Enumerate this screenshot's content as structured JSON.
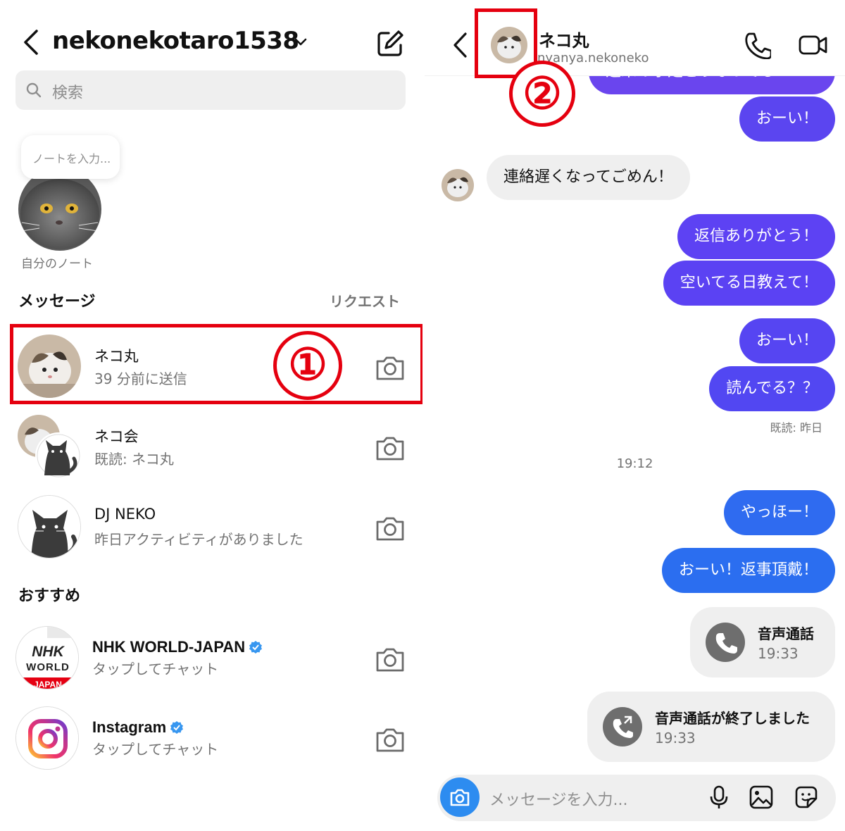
{
  "left": {
    "username": "nekonekotaro1538",
    "search_placeholder": "検索",
    "note_placeholder": "ノートを入力...",
    "note_label": "自分のノート",
    "messages_heading": "メッセージ",
    "requests_link": "リクエスト",
    "conversations": [
      {
        "name": "ネコ丸",
        "subtitle": "39 分前に送信"
      },
      {
        "name": "ネコ会",
        "subtitle": "既読: ネコ丸"
      },
      {
        "name": "DJ NEKO",
        "subtitle": "昨日アクティビティがありました"
      }
    ],
    "suggested_heading": "おすすめ",
    "suggested": [
      {
        "name": "NHK WORLD-JAPAN",
        "subtitle": "タップしてチャット",
        "logo_lines": [
          "NHK",
          "WORLD",
          "JAPAN"
        ]
      },
      {
        "name": "Instagram",
        "subtitle": "タップしてチャット"
      }
    ],
    "step_marker": "①"
  },
  "right": {
    "contact_name": "ネコ丸",
    "contact_handle": "nyanya.nekoneko",
    "step_marker": "②",
    "messages": [
      {
        "from": "me",
        "text": "週末の予定どうなってる？"
      },
      {
        "from": "me",
        "text": "おーい！"
      },
      {
        "from": "them",
        "text": "連絡遅くなってごめん！"
      },
      {
        "from": "me",
        "text": "返信ありがとう！"
      },
      {
        "from": "me",
        "text": "空いてる日教えて！"
      },
      {
        "from": "me",
        "text": "おーい！"
      },
      {
        "from": "me",
        "text": "読んでる？？"
      }
    ],
    "read_receipt": "既読: 昨日",
    "timestamp": "19:12",
    "messages2": [
      {
        "from": "me",
        "text": "やっほー！"
      },
      {
        "from": "me",
        "text": "おーい！返事頂戴！"
      }
    ],
    "calls": [
      {
        "title": "音声通話",
        "time": "19:33"
      },
      {
        "title": "音声通話が終了しました",
        "time": "19:33"
      }
    ],
    "composer_placeholder": "メッセージを入力..."
  },
  "colors": {
    "accent_purple": "#5b4bf5",
    "accent_blue": "#2f6bf0",
    "highlight_red": "#e5000f",
    "bubble_gray": "#efefef"
  }
}
